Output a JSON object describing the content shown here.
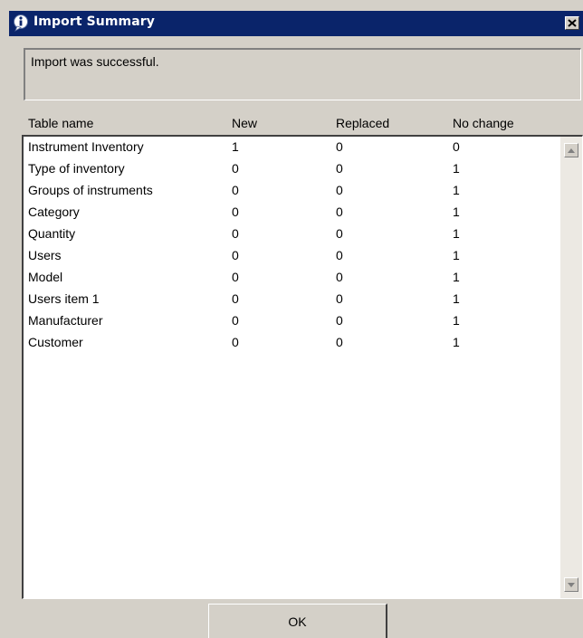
{
  "window": {
    "title": "Import Summary"
  },
  "message": "Import was successful.",
  "columns": {
    "name": "Table name",
    "new": "New",
    "replaced": "Replaced",
    "no_change": "No change"
  },
  "rows": [
    {
      "name": "Instrument Inventory",
      "new": "1",
      "replaced": "0",
      "no_change": "0"
    },
    {
      "name": "Type of inventory",
      "new": "0",
      "replaced": "0",
      "no_change": "1"
    },
    {
      "name": "Groups of instruments",
      "new": "0",
      "replaced": "0",
      "no_change": "1"
    },
    {
      "name": "Category",
      "new": "0",
      "replaced": "0",
      "no_change": "1"
    },
    {
      "name": "Quantity",
      "new": "0",
      "replaced": "0",
      "no_change": "1"
    },
    {
      "name": "Users",
      "new": "0",
      "replaced": "0",
      "no_change": "1"
    },
    {
      "name": "Model",
      "new": "0",
      "replaced": "0",
      "no_change": "1"
    },
    {
      "name": "Users item 1",
      "new": "0",
      "replaced": "0",
      "no_change": "1"
    },
    {
      "name": "Manufacturer",
      "new": "0",
      "replaced": "0",
      "no_change": "1"
    },
    {
      "name": "Customer",
      "new": "0",
      "replaced": "0",
      "no_change": "1"
    }
  ],
  "buttons": {
    "ok": "OK"
  },
  "icons": {
    "title": "info-icon",
    "close": "close-icon",
    "scroll_up": "arrow-up-icon",
    "scroll_down": "arrow-down-icon"
  },
  "colors": {
    "titlebar": "#0a246a",
    "face": "#d4d0c8",
    "list_bg": "#ffffff"
  }
}
